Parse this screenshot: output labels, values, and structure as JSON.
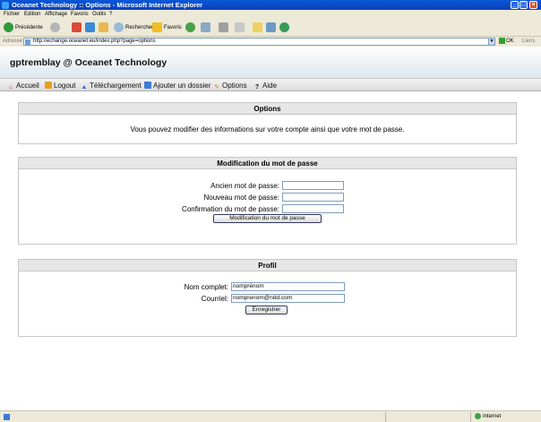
{
  "window": {
    "title": "Oceanet Technology :: Options - Microsoft Internet Explorer"
  },
  "menubar": {
    "items": [
      "Fichier",
      "Edition",
      "Affichage",
      "Favoris",
      "Outils",
      "?"
    ]
  },
  "toolbar": {
    "back_label": "Précédente",
    "search_label": "Rechercher",
    "favorites_label": "Favoris"
  },
  "addressbar": {
    "label": "Adresse",
    "url": "http://echange.oceanet.eu/index.php?page=options",
    "go_label": "OK",
    "links_label": "Liens"
  },
  "header": {
    "user_title": "gptremblay @ Oceanet Technology"
  },
  "nav": {
    "items": [
      {
        "label": "Accueil",
        "icon": "home-icon"
      },
      {
        "label": "Logout",
        "icon": "logout-icon"
      },
      {
        "label": "Téléchargement",
        "icon": "download-icon"
      },
      {
        "label": "Ajouter un dossier",
        "icon": "add-folder-icon"
      },
      {
        "label": "Options",
        "icon": "options-icon"
      },
      {
        "label": "Aide",
        "icon": "help-icon"
      }
    ]
  },
  "options": {
    "title": "Options",
    "message": "Vous pouvez modifier des informations sur votre compte ainsi que votre mot de passe."
  },
  "password": {
    "title": "Modification du mot de passe",
    "old_label": "Ancien mot de passe:",
    "new_label": "Nouveau mot de passe:",
    "confirm_label": "Confirmation du mot de passe:",
    "old_value": "",
    "new_value": "",
    "confirm_value": "",
    "button_label": "Modification du mot de passe"
  },
  "profile": {
    "title": "Profil",
    "name_label": "Nom complet:",
    "name_value": "nomprénom",
    "email_label": "Courriel:",
    "email_value": "nomprenom@ndd.com",
    "save_label": "Enregistrer"
  },
  "statusbar": {
    "zone_label": "Internet"
  },
  "colors": {
    "titlebar": "#0a58d8",
    "chrome": "#ece9d8",
    "box_header": "#e6e6e6"
  }
}
